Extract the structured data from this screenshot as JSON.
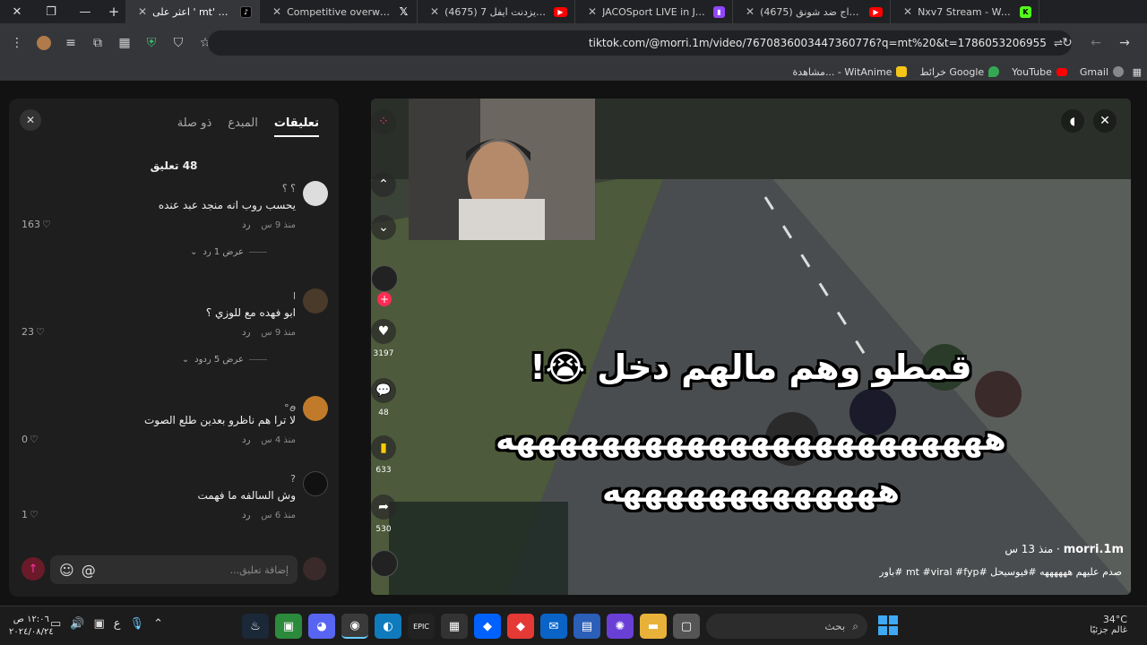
{
  "window": {
    "close": "✕",
    "restore": "❐",
    "minimize": "—"
  },
  "tabs": [
    {
      "title": "اعثر على ' mt' على TikTok",
      "icon": "tiktok-icon",
      "active": true
    },
    {
      "title": "Competitive overwatch / X",
      "icon": "x-icon"
    },
    {
      "title": "(4675) تختيم ريزدنت ايفل 7",
      "icon": "youtube-icon"
    },
    {
      "title": "JACOSport LIVE in JACO -",
      "icon": "twitch-icon"
    },
    {
      "title": "(4675) تيم الابراج ضد شونق",
      "icon": "youtube-icon"
    },
    {
      "title": "Nxv7 Stream - Watch Live",
      "icon": "kick-icon"
    }
  ],
  "new_tab_label": "+",
  "address": {
    "url": "tiktok.com/@morri.1m/video/7670836003447360776?q=mt%20&t=1786053206955"
  },
  "bookmarks": [
    {
      "label": "Gmail",
      "color": "#ea4335"
    },
    {
      "label": "YouTube",
      "color": "#ff0000"
    },
    {
      "label": "خرائط Google",
      "color": "#34a853"
    },
    {
      "label": "مشاهدة... - WitAnime",
      "color": "#f5c518"
    }
  ],
  "comments_panel": {
    "tabs": [
      "تعليقات",
      "المبدع",
      "ذو صلة"
    ],
    "count_label": "48 تعليق",
    "reply_label": "رد",
    "items": [
      {
        "user": "؟ ؟",
        "text": "يحسب روب انه منجد عبد عنده",
        "time": "منذ 9 س",
        "likes": "163",
        "view_replies": "عرض 1 رد"
      },
      {
        "user": "l",
        "text": "ابو فهده مع للوزي ؟",
        "time": "منذ 9 س",
        "likes": "23",
        "view_replies": "عرض 5 ردود"
      },
      {
        "user": "ꪮ°",
        "text": "لا ترا هم ناظرو بعدين طلع الصوت",
        "time": "منذ 4 س",
        "likes": "0",
        "view_replies": ""
      },
      {
        "user": "?",
        "text": "وش السالفه ما فهمت",
        "time": "منذ 6 س",
        "likes": "1",
        "view_replies": ""
      }
    ],
    "input_placeholder": "إضافة تعليق..."
  },
  "video": {
    "caption_line1": "قمطو وهم مالهم دخل 😭!",
    "caption_line2": "هههههههههههههههههههههههه",
    "caption_line3": "هههههههههههههه",
    "author": "morri.1m",
    "posted": "منذ 13 س",
    "description": "صدم عليهم ههههههه #فيوسيحل #mt #viral #fyp #باور",
    "stats": {
      "likes": "3197",
      "comments": "48",
      "saves": "633",
      "shares": "530"
    }
  },
  "taskbar": {
    "search_label": "بحث",
    "weather_temp": "34°C",
    "weather_desc": "غالم جزئيًا",
    "time": "١٢:٠٦ ص",
    "date": "٢٠٢٤/٠٨/٢٤",
    "lang": "ع"
  }
}
